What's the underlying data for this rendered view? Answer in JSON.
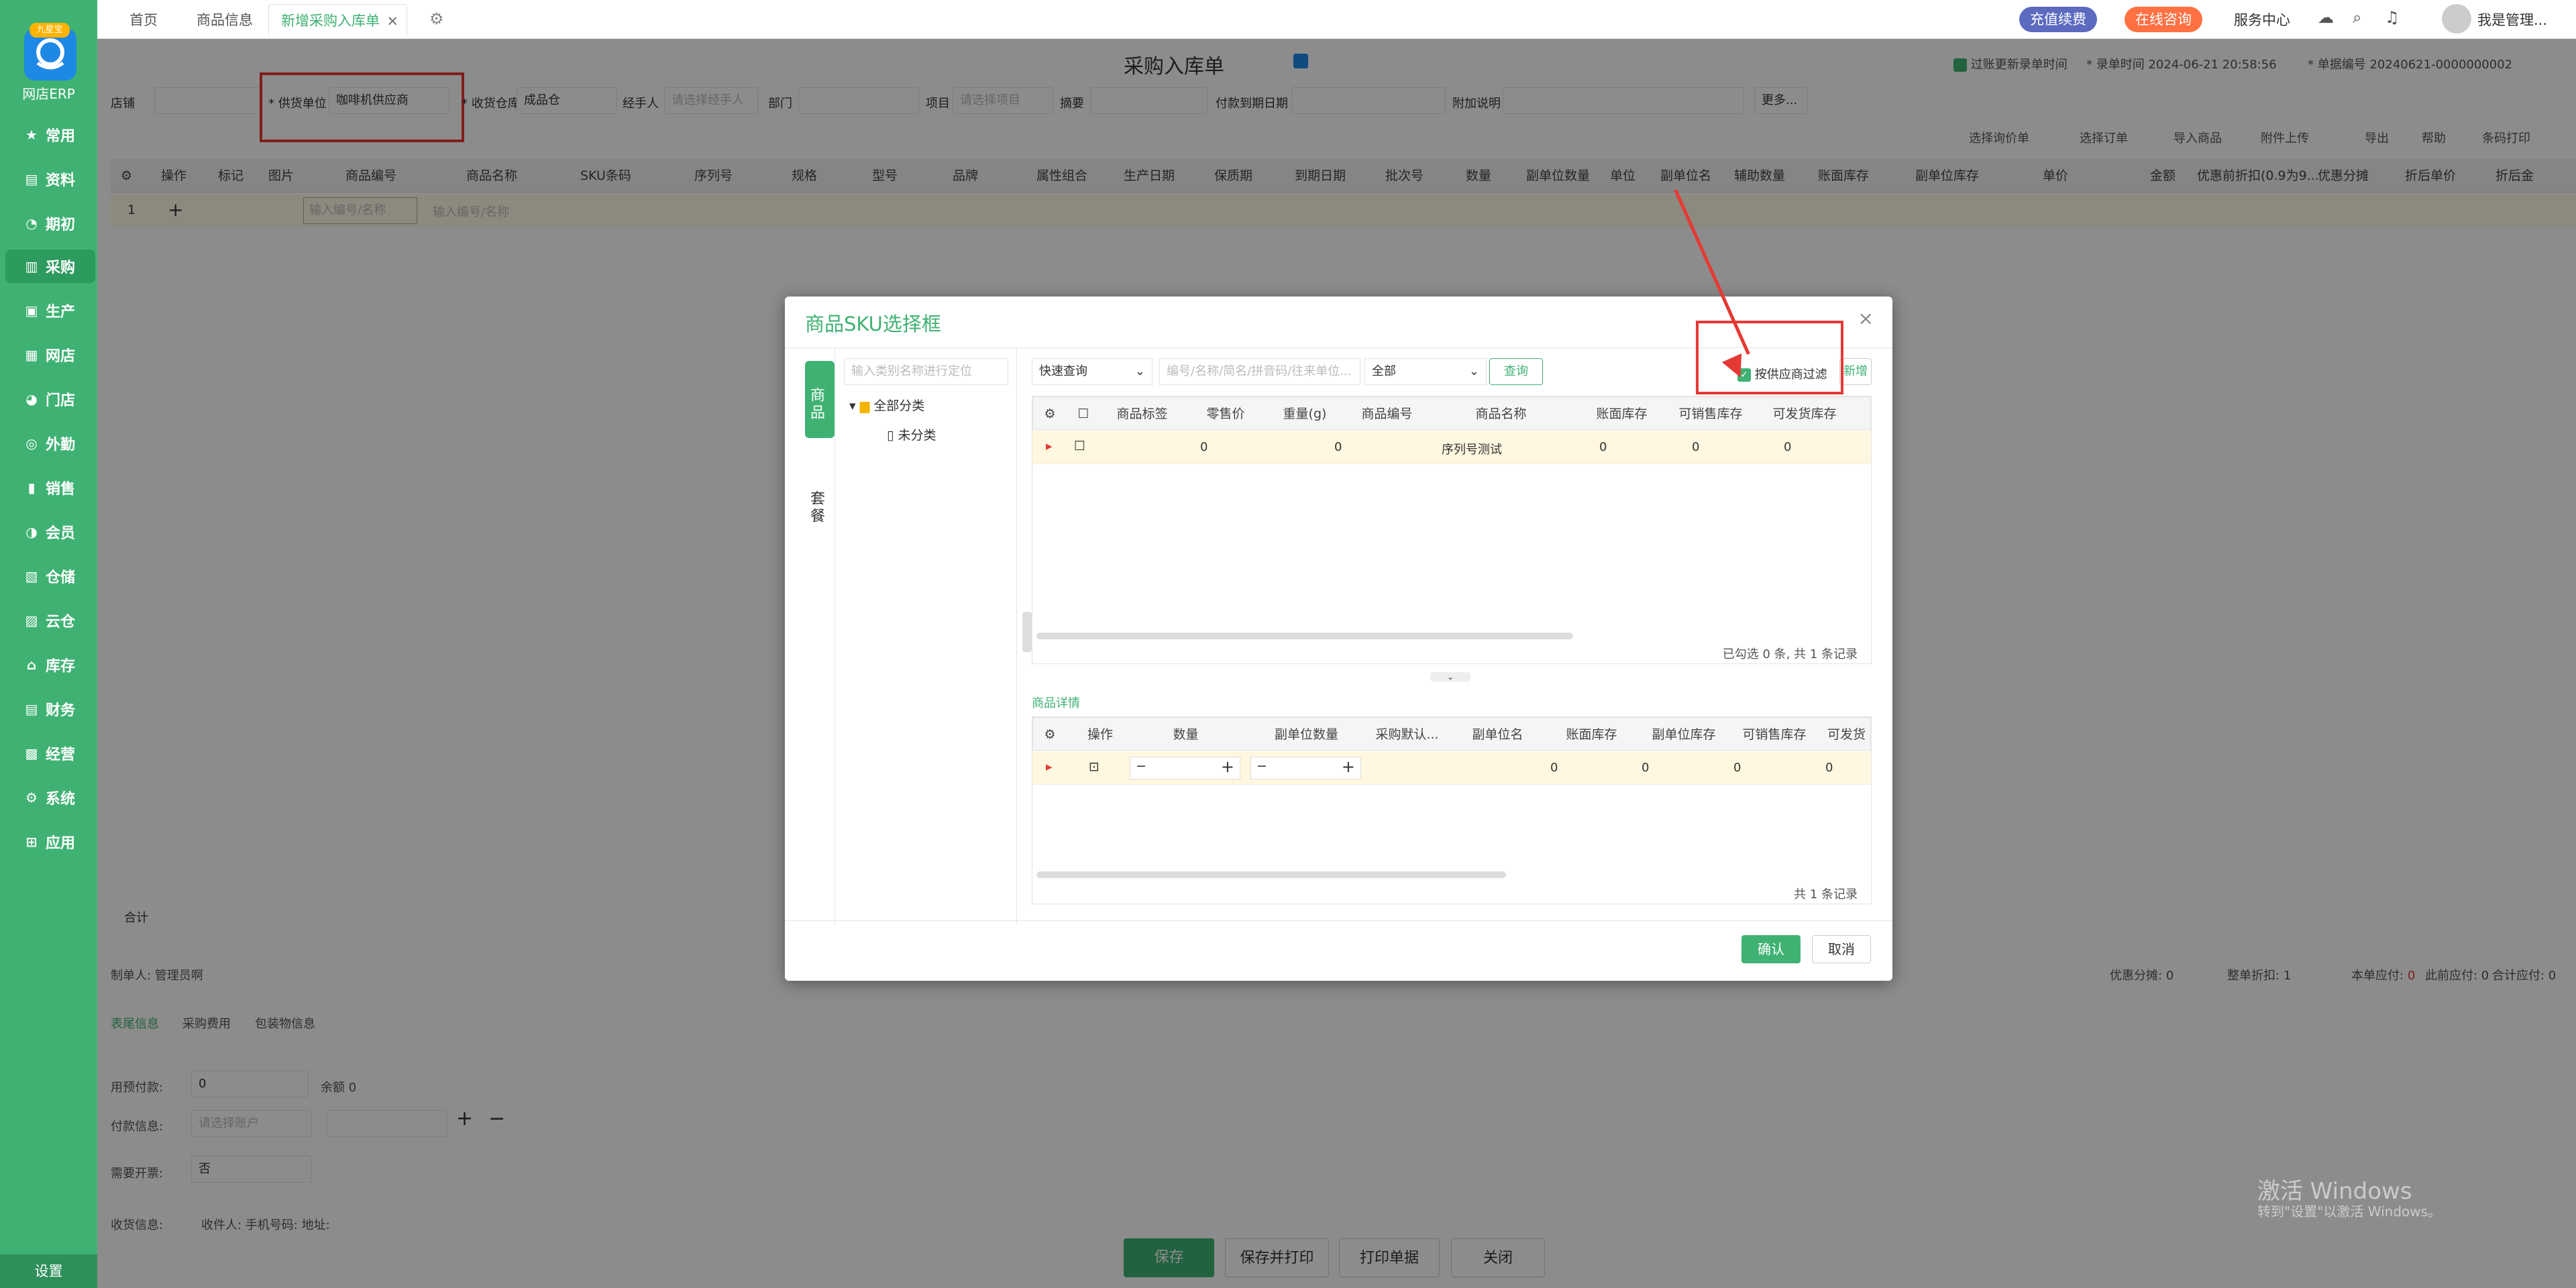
{
  "sidebar": {
    "logo_badge": "九星宝",
    "logo_text": "网店ERP",
    "items": [
      {
        "label": "常用",
        "icon": "star-icon"
      },
      {
        "label": "资料",
        "icon": "document-icon"
      },
      {
        "label": "期初",
        "icon": "clock-icon"
      },
      {
        "label": "采购",
        "icon": "purchase-icon"
      },
      {
        "label": "生产",
        "icon": "production-icon"
      },
      {
        "label": "网店",
        "icon": "shop-icon"
      },
      {
        "label": "门店",
        "icon": "store-icon"
      },
      {
        "label": "外勤",
        "icon": "field-icon"
      },
      {
        "label": "销售",
        "icon": "sales-icon"
      },
      {
        "label": "会员",
        "icon": "member-icon"
      },
      {
        "label": "仓储",
        "icon": "warehouse-icon"
      },
      {
        "label": "云仓",
        "icon": "cloud-warehouse-icon"
      },
      {
        "label": "库存",
        "icon": "inventory-icon"
      },
      {
        "label": "财务",
        "icon": "finance-icon"
      },
      {
        "label": "经营",
        "icon": "business-icon"
      },
      {
        "label": "系统",
        "icon": "system-icon"
      },
      {
        "label": "应用",
        "icon": "apps-icon"
      }
    ],
    "settings": "设置"
  },
  "topbar": {
    "tabs": [
      "首页",
      "商品信息",
      "新增采购入库单"
    ],
    "recharge": "充值续费",
    "consult": "在线咨询",
    "service": "服务中心",
    "user": "我是管理..."
  },
  "page": {
    "title": "采购入库单",
    "refresh_time": "过账更新录单时间",
    "record_time_label": "* 录单时间",
    "record_time": "2024-06-21 20:58:56",
    "doc_no_label": "* 单据编号",
    "doc_no": "20240621-0000000002",
    "fields": {
      "shop": "店铺",
      "supplier": "* 供货单位",
      "supplier_value": "咖啡机供应商",
      "warehouse": "* 收货仓库",
      "warehouse_value": "成品仓",
      "handler": "经手人",
      "handler_ph": "请选择经手人",
      "dept": "部门",
      "project": "项目",
      "project_ph": "请选择项目",
      "summary": "摘要",
      "due_date": "付款到期日期",
      "note": "附加说明",
      "more": "更多..."
    },
    "actions": [
      "选择询价单",
      "选择订单",
      "导入商品",
      "附件上传",
      "导出",
      "帮助",
      "条码打印"
    ],
    "grid_headers": [
      "操作",
      "标记",
      "图片",
      "商品编号",
      "商品名称",
      "SKU条码",
      "序列号",
      "规格",
      "型号",
      "品牌",
      "属性组合",
      "生产日期",
      "保质期",
      "到期日期",
      "批次号",
      "数量",
      "副单位数量",
      "单位",
      "副单位名",
      "辅助数量",
      "账面库存",
      "副单位库存",
      "单价",
      "金额",
      "优惠前折扣(0.9为9...",
      "优惠分摊",
      "折后单价",
      "折后金"
    ],
    "row1_no": "1",
    "row1_ph1": "输入编号/名称",
    "row1_ph2": "输入编号/名称",
    "total_label": "合计",
    "maker": "制单人: 管理员啊",
    "discount_share": "优惠分摊:",
    "discount_share_val": "0",
    "whole_discount": "整单折扣:",
    "whole_discount_val": "1",
    "payable": "本单应付:",
    "payable_val": "0",
    "prev_payable": "此前应付: 0",
    "total_payable": "合计应付: 0",
    "bottom_tabs": [
      "表尾信息",
      "采购费用",
      "包装物信息"
    ],
    "prepay": "用预付款:",
    "prepay_val": "0",
    "balance": "余额 0",
    "payinfo": "付款信息:",
    "payinfo_ph": "请选择账户",
    "invoice": "需要开票:",
    "invoice_val": "否",
    "receiver": "收货信息:",
    "receiver_sub": "收件人:   手机号码:   地址:",
    "buttons": [
      "保存",
      "保存并打印",
      "打印单据",
      "关闭"
    ],
    "windows_line1": "激活 Windows",
    "windows_line2": "转到\"设置\"以激活 Windows。"
  },
  "modal": {
    "title": "商品SKU选择框",
    "vtab1": "商品",
    "vtab2": "套餐",
    "cat_search_ph": "输入类别名称进行定位",
    "tree_root": "全部分类",
    "tree_child": "未分类",
    "query_type": "快速查询",
    "search_ph": "编号/名称/简名/拼音码/往来单位...",
    "scope": "全部",
    "query_btn": "查询",
    "filter_label": "按供应商过滤",
    "new_btn": "新增",
    "headers": [
      "商品标签",
      "零售价",
      "重量(g)",
      "商品编号",
      "商品名称",
      "账面库存",
      "可销售库存",
      "可发货库存"
    ],
    "row": [
      "",
      "0",
      "0",
      "",
      "序列号测试",
      "0",
      "0",
      "0"
    ],
    "status": "已勾选 0 条, 共 1 条记录",
    "detail_label": "商品详情",
    "detail_headers": [
      "操作",
      "数量",
      "副单位数量",
      "采购默认...",
      "副单位名",
      "账面库存",
      "副单位库存",
      "可销售库存",
      "可发货"
    ],
    "detail_row": [
      "",
      "",
      "",
      "",
      "",
      "0",
      "0",
      "0",
      "0"
    ],
    "detail_status": "共 1 条记录",
    "confirm": "确认",
    "cancel": "取消"
  },
  "colors": {
    "brand": "#3fb273",
    "annotation": "#e53935"
  }
}
